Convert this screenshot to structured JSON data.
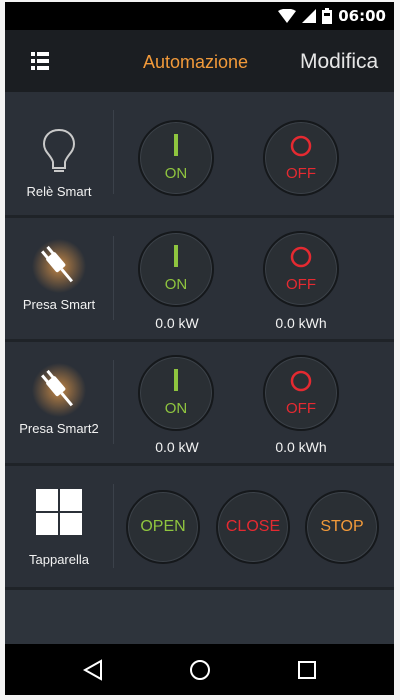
{
  "status": {
    "time": "06:00"
  },
  "header": {
    "tab_active": "Automazione",
    "tab_other": "Modifica"
  },
  "devices": [
    {
      "name": "Relè Smart",
      "icon": "bulb-icon",
      "on_label": "ON",
      "off_label": "OFF"
    },
    {
      "name": "Presa Smart",
      "icon": "plug-icon",
      "on_label": "ON",
      "off_label": "OFF",
      "power": "0.0 kW",
      "energy": "0.0 kWh"
    },
    {
      "name": "Presa Smart2",
      "icon": "plug-icon",
      "on_label": "ON",
      "off_label": "OFF",
      "power": "0.0 kW",
      "energy": "0.0 kWh"
    },
    {
      "name": "Tapparella",
      "icon": "window-icon",
      "open_label": "OPEN",
      "close_label": "CLOSE",
      "stop_label": "STOP"
    }
  ],
  "colors": {
    "accent": "#f29a3a",
    "on": "#8fc53f",
    "off": "#e52a31",
    "background": "#2b3038"
  }
}
